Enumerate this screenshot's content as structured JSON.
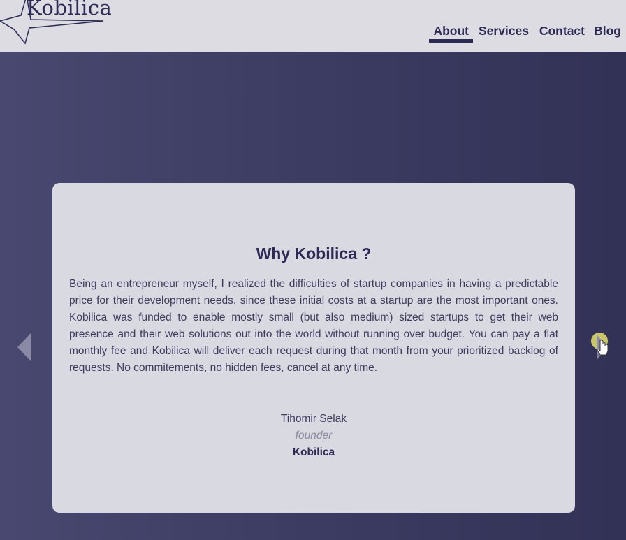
{
  "header": {
    "logo_text": "Kobilica",
    "nav": [
      {
        "label": "About",
        "active": true
      },
      {
        "label": "Services",
        "active": false
      },
      {
        "label": "Contact",
        "active": false
      },
      {
        "label": "Blog",
        "active": false
      }
    ]
  },
  "testimonial": {
    "title": "Why Kobilica ?",
    "body": "Being an entrepreneur myself, I realized the difficulties of startup companies in having a predictable price for their development needs, since these initial costs at a startup are the most important ones. Kobilica was funded to enable mostly small (but also medium) sized startups to get their web presence and their web solutions out into the world without running over budget. You can pay a flat monthly fee and Kobilica will deliver each request during that month from your prioritized backlog of requests. No commitements, no hidden fees, cancel at any time.",
    "author_name": "Tihomir Selak",
    "author_role": "founder",
    "author_company": "Kobilica"
  },
  "carousel": {
    "prev_icon": "chevron-left-icon",
    "next_icon": "chevron-right-icon"
  },
  "colors": {
    "brand": "#2d2b55",
    "background": "#dcdce2",
    "hero_start": "#484870",
    "hero_end": "#323156",
    "card": "#d9d9e1",
    "cursor_highlight": "#c9c56a"
  }
}
